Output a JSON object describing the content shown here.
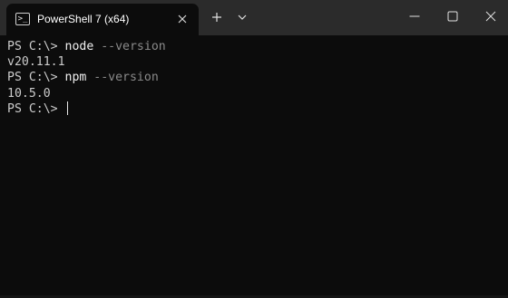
{
  "window": {
    "tab_title": "PowerShell 7 (x64)",
    "tab_icon": "powershell-icon"
  },
  "titlebar": {
    "new_tab_icon": "plus-icon",
    "dropdown_icon": "chevron-down-icon",
    "minimize_icon": "minimize-icon",
    "maximize_icon": "maximize-icon",
    "close_icon": "close-icon"
  },
  "terminal": {
    "lines": [
      {
        "prompt": "PS C:\\> ",
        "command": "node",
        "args": " --version"
      },
      {
        "output": "v20.11.1"
      },
      {
        "prompt": "PS C:\\> ",
        "command": "npm",
        "args": " --version"
      },
      {
        "output": "10.5.0"
      },
      {
        "prompt": "PS C:\\> "
      }
    ]
  },
  "colors": {
    "background": "#0c0c0c",
    "titlebar": "#2b2b2b",
    "text": "#cccccc",
    "argument_text": "#8a8a8a"
  }
}
